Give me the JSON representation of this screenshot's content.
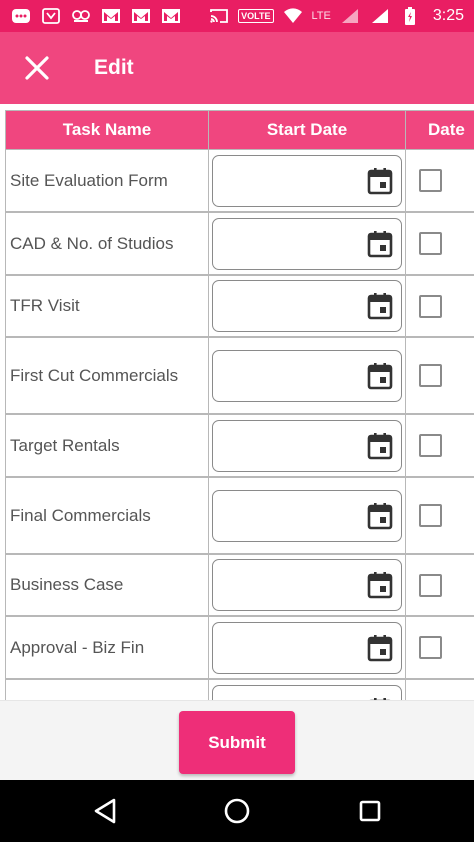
{
  "status_bar": {
    "volte": "VOLTE",
    "lte": "LTE",
    "time": "3:25",
    "icons": [
      "more-icon",
      "app-icon",
      "glasses-icon",
      "gmail-icon",
      "gmail-icon",
      "gmail-icon",
      "cast-icon",
      "wifi-icon",
      "signal-icon",
      "battery-icon"
    ]
  },
  "app_bar": {
    "title": "Edit",
    "close_icon": "close-icon"
  },
  "table": {
    "headers": [
      "Task Name",
      "Start Date",
      "Date"
    ],
    "rows": [
      {
        "task": "Site Evaluation Form"
      },
      {
        "task": "CAD & No. of Studios"
      },
      {
        "task": "TFR Visit"
      },
      {
        "task": "First Cut Commercials"
      },
      {
        "task": "Target Rentals"
      },
      {
        "task": "Final Commercials"
      },
      {
        "task": "Business Case"
      },
      {
        "task": "Approval - Biz Fin"
      },
      {
        "task": ""
      }
    ]
  },
  "footer": {
    "submit_label": "Submit"
  },
  "colors": {
    "status_bar": "#e91e63",
    "app_bar": "#f0467f",
    "header": "#f0467f",
    "submit": "#ee2e78"
  }
}
